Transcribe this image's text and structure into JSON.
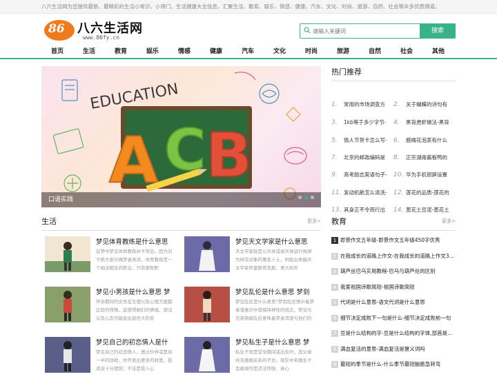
{
  "topbar": {
    "text": "八六生活网为您提供最新、最精彩的生活小常识、小窍门、生活健康大全信息，汇聚生活、教育、娱乐、情感、健康、汽车、文化、时尚、旅游、自然、社会等众多优质频道。"
  },
  "logo": {
    "number": "86",
    "name": "八六生活网",
    "url": "www.86fy.cn"
  },
  "search": {
    "placeholder": "请输入关键词",
    "button": "搜索"
  },
  "nav": [
    "首页",
    "生活",
    "教育",
    "娱乐",
    "情感",
    "健康",
    "汽车",
    "文化",
    "时尚",
    "旅游",
    "自然",
    "社会",
    "其他"
  ],
  "banner": {
    "caption": "口语实践",
    "art": {
      "education": "EDUCATION",
      "letter_a": "A",
      "letter_c": "C",
      "letter_b": "B"
    },
    "active_slide": 2
  },
  "hot": {
    "title": "热门推荐",
    "items": [
      {
        "num": "1.",
        "text": "常用的市场调查方"
      },
      {
        "num": "2.",
        "text": "关于蝴蝶的诗句有"
      },
      {
        "num": "3.",
        "text": "1kb等于多少字节-"
      },
      {
        "num": "4.",
        "text": "黑背虎虾做法-黑背"
      },
      {
        "num": "5.",
        "text": "情人节贺卡怎么写-"
      },
      {
        "num": "6.",
        "text": "腊梅花泡茶有什么"
      },
      {
        "num": "7.",
        "text": "北京的邮政编码是"
      },
      {
        "num": "8.",
        "text": "正宗湖南酱板鸭的"
      },
      {
        "num": "9.",
        "text": "高考励志英语句子-"
      },
      {
        "num": "10.",
        "text": "华为手机锁屏设置"
      },
      {
        "num": "11.",
        "text": "发动机舱怎么清洗-"
      },
      {
        "num": "12.",
        "text": "莲花的品质-莲花的"
      },
      {
        "num": "13.",
        "text": "其身正不令而行出"
      },
      {
        "num": "14.",
        "text": "葱花土豆泥-葱花土"
      }
    ]
  },
  "life": {
    "title": "生活",
    "more": "更多>",
    "cards": [
      {
        "title": "梦见体育教练是什么意思",
        "desc": "在梦中梦见体育教练并不常见。因为对于绝大部分做梦者来说，体育教练是一个相当陌生的职业，只有那些职"
      },
      {
        "title": "梦见天文学家是什么意思",
        "desc": "天文学家就是以天体或者天体运行规律为研究对象的著名人士，例如古希腊天文学家阿里斯塔克斯、意大利天"
      },
      {
        "title": "梦见小男孩是什么意思 梦",
        "desc": "怀孕期间的女性在生理以及心理方面都比较的特殊，这使得她们的情绪、想法以及心态可能会出现巨大的变"
      },
      {
        "title": "梦见乱伦是什么意思 梦到",
        "desc": "梦见乱伦是什么意思?梦到乱伦预示着梦者潜意识中想保持神性的纯正。梦见与兄弟姐妹乱伦意味着梦者渴望与他们的关"
      },
      {
        "title": "梦见自己的初恋情人是什",
        "desc": "梦见自己的初恋情人，透过伙伴或是另一半的协助，你开发出更多的财富，投资设十分理想；不论是投入心"
      },
      {
        "title": "梦见私生子是什么意思 梦",
        "desc": "私生子就是受孕期间或出生时，其父母并无婚姻关系的子女。现实中未婚生子会被视作是违法怀胎，身心"
      }
    ]
  },
  "education": {
    "title": "教育",
    "more": "更多>",
    "items": [
      {
        "num": "1",
        "text": "即景作文五年级-即景作文五年级450字优秀"
      },
      {
        "num": "2",
        "text": "在我成长的道路上作文-在我成长的道路上作文3..."
      },
      {
        "num": "3",
        "text": "葫芦丝巴乌实用教程-巴乌与葫芦丝的区别"
      },
      {
        "num": "4",
        "text": "我爱祖国诗歌简短-祖国诗歌简短"
      },
      {
        "num": "5",
        "text": "代词是什么意思-语文代词是什么意思"
      },
      {
        "num": "6",
        "text": "细节决定成败下一句是什么-细节决定成败前一句"
      },
      {
        "num": "7",
        "text": "豆是什么结构的字-豆是什么结构的字体,部首是..."
      },
      {
        "num": "8",
        "text": "满血复活的意思-满血复活是褒义词吗"
      },
      {
        "num": "9",
        "text": "最短的季节是什么-什么季节最短脑筋急转弯"
      }
    ]
  },
  "colors": {
    "accent": "#39b287",
    "logo_orange": "#f07b1c"
  }
}
